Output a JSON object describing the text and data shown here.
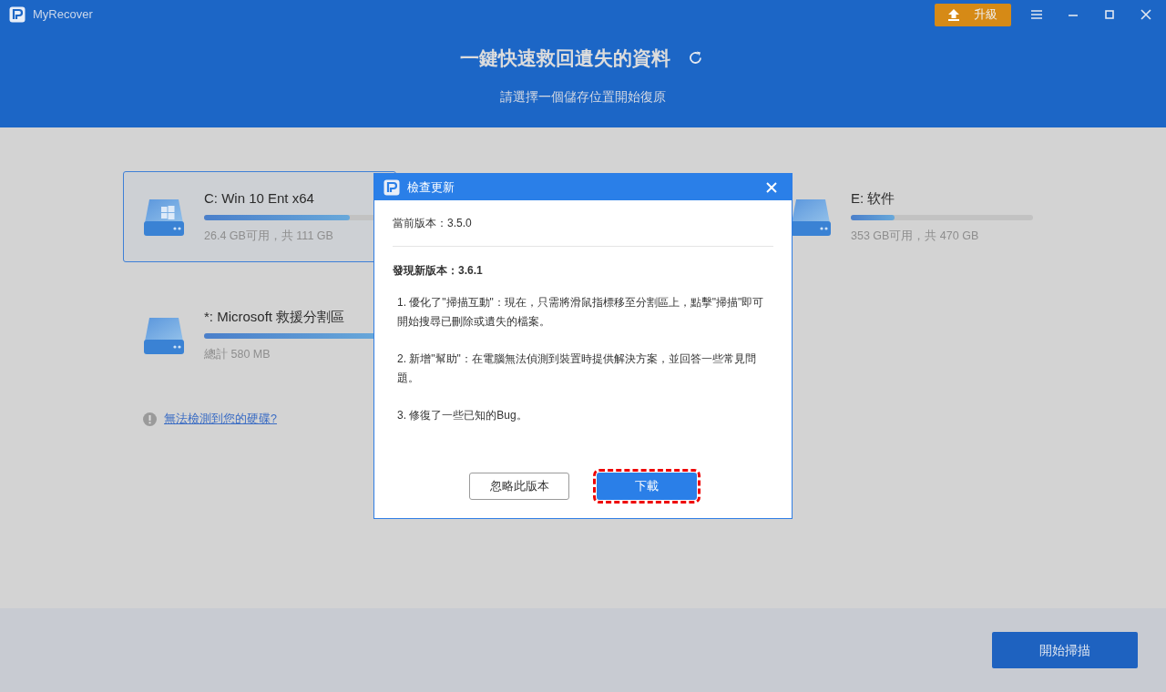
{
  "window": {
    "title": "MyRecover"
  },
  "upgrade_button": {
    "label": "升級"
  },
  "header": {
    "title": "一鍵快速救回遺失的資料",
    "subtitle": "請選擇一個儲存位置開始復原"
  },
  "drives": [
    {
      "name": "C: Win 10 Ent x64",
      "kind": "system",
      "selected": true,
      "level": 0.8,
      "info": "26.4 GB可用，共 111 GB"
    },
    {
      "name": "E: 软件",
      "kind": "plain",
      "selected": false,
      "level": 0.24,
      "info": "353 GB可用，共 470 GB"
    },
    {
      "name": "*: Microsoft 救援分割區",
      "kind": "plain",
      "selected": false,
      "level": 0.97,
      "info": "總計 580 MB"
    }
  ],
  "help_link": "無法檢測到您的硬碟?",
  "scan_button": "開始掃描",
  "dialog": {
    "title": "檢查更新",
    "current_version": "當前版本：3.5.0",
    "new_version": "發現新版本：3.6.1",
    "notes": [
      "1. 優化了\"掃描互動\"：現在，只需將滑鼠指標移至分割區上，點擊\"掃描\"即可開始搜尋已刪除或遺失的檔案。",
      "2. 新增\"幫助\"：在電腦無法偵測到裝置時提供解決方案，並回答一些常見問題。",
      "3. 修復了一些已知的Bug。"
    ],
    "buttons": [
      {
        "label": "忽略此版本",
        "kind": "secondary",
        "highlighted": false
      },
      {
        "label": "下載",
        "kind": "primary",
        "highlighted": true
      }
    ]
  }
}
